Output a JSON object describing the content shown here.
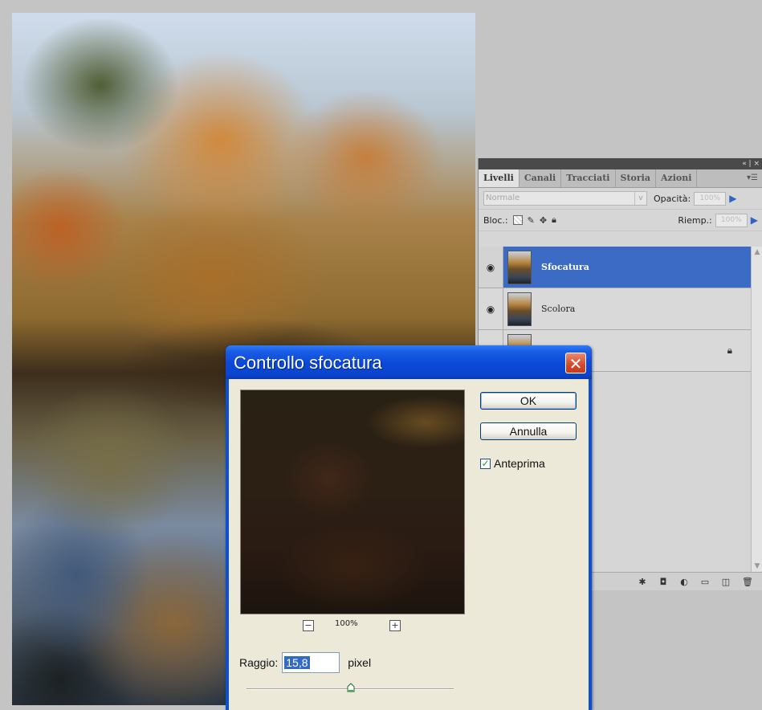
{
  "layers_panel": {
    "tabs": [
      {
        "label": "Livelli",
        "active": true
      },
      {
        "label": "Canali",
        "active": false
      },
      {
        "label": "Tracciati",
        "active": false
      },
      {
        "label": "Storia",
        "active": false
      },
      {
        "label": "Azioni",
        "active": false
      }
    ],
    "topbar_controls": "«  |  ×",
    "tab_menu_icon": "menu-icon",
    "blend_mode": "Normale",
    "opacity_label": "Opacità:",
    "opacity_value": "100%",
    "lock_label": "Bloc.:",
    "fill_label": "Riemp.:",
    "fill_value": "100%",
    "layers": [
      {
        "name": "Sfocatura",
        "selected": true,
        "visible": true,
        "locked": false
      },
      {
        "name": "Scolora",
        "selected": false,
        "visible": true,
        "locked": false
      },
      {
        "name": "",
        "selected": false,
        "visible": false,
        "locked": true
      }
    ]
  },
  "dialog": {
    "title": "Controllo sfocatura",
    "ok_label": "OK",
    "cancel_label": "Annulla",
    "preview_label": "Anteprima",
    "preview_checked": true,
    "zoom_level": "100%",
    "radius_label": "Raggio:",
    "radius_value": "15,8",
    "radius_unit": "pixel"
  },
  "colors": {
    "titlebar_blue": "#0a48d6",
    "selected_layer": "#3b6bc4",
    "dialog_body": "#ece9d8",
    "close_red": "#d5482a"
  }
}
